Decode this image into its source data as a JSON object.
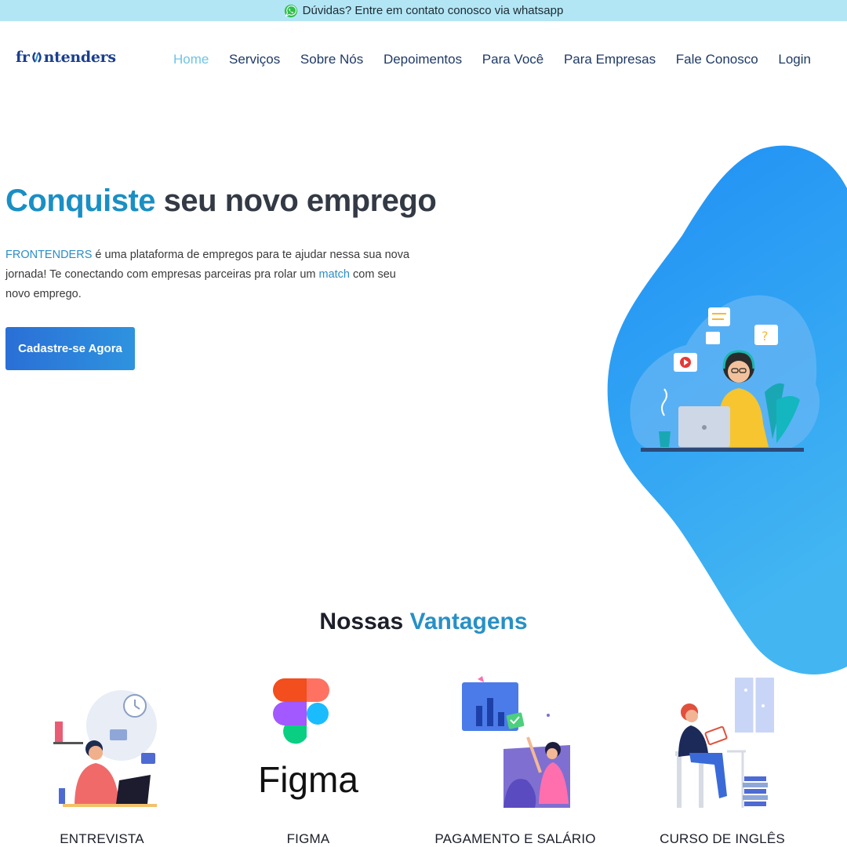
{
  "topbar": {
    "text": "Dúvidas? Entre em contato conosco via whatsapp",
    "icon": "whatsapp-icon"
  },
  "header": {
    "logo_text_left": "fr",
    "logo_text_right": "ntenders",
    "nav": [
      {
        "label": "Home",
        "active": true
      },
      {
        "label": "Serviços"
      },
      {
        "label": "Sobre Nós"
      },
      {
        "label": "Depoimentos"
      },
      {
        "label": "Para Você"
      },
      {
        "label": "Para Empresas"
      },
      {
        "label": "Fale Conosco"
      },
      {
        "label": "Login"
      }
    ]
  },
  "hero": {
    "title_accent": "Conquiste",
    "title_rest": "seu novo emprego",
    "text_brand": "FRONTENDERS",
    "text_part1": " é uma plataforma de empregos para te ajudar nessa sua nova jornada! Te conectando com empresas parceiras pra rolar um ",
    "text_link": "match",
    "text_part2": " com seu novo emprego.",
    "cta_label": "Cadastre-se Agora"
  },
  "vantagens": {
    "title_plain": "Nossas",
    "title_accent": "Vantagens",
    "figma_wordmark": "Figma",
    "items": [
      {
        "label": "ENTREVISTA"
      },
      {
        "label": "FIGMA"
      },
      {
        "label": "PAGAMENTO E SALÁRIO"
      },
      {
        "label": "CURSO DE INGLÊS"
      }
    ]
  },
  "colors": {
    "accent": "#1a8fc4",
    "topbar": "#b3e6f4",
    "nav_active": "#6ec5e6",
    "cta": "#2a6fd6"
  }
}
